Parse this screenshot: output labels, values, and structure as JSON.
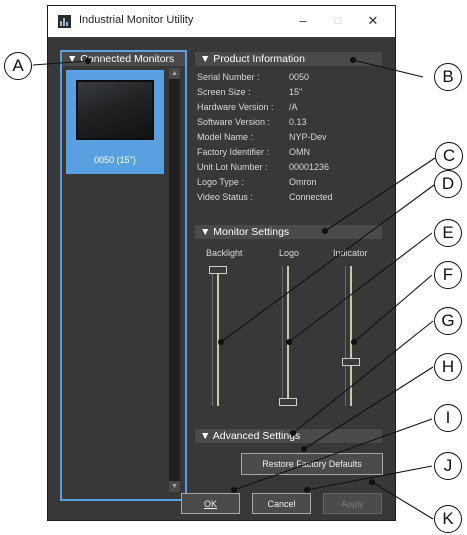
{
  "window": {
    "title": "Industrial Monitor Utility",
    "minimize_symbol": "–",
    "maximize_symbol": "□",
    "close_symbol": "✕"
  },
  "connected_monitors": {
    "header": "▼ Connected Monitors",
    "items": [
      {
        "label": "0050 (15\")",
        "selected": true
      }
    ]
  },
  "product_information": {
    "header": "▼ Product Information",
    "rows": [
      {
        "label": "Serial Number :",
        "value": "0050"
      },
      {
        "label": "Screen Size :",
        "value": "15\""
      },
      {
        "label": "Hardware Version :",
        "value": "/A"
      },
      {
        "label": "Software Version :",
        "value": "0.13"
      },
      {
        "label": "Model Name :",
        "value": "NYP-Dev"
      },
      {
        "label": "Factory Identifier :",
        "value": "OMN"
      },
      {
        "label": "Unit Lot Number :",
        "value": "00001236"
      },
      {
        "label": "Logo Type :",
        "value": "Omron"
      },
      {
        "label": "Video Status :",
        "value": "Connected"
      }
    ]
  },
  "monitor_settings": {
    "header": "▼ Monitor Settings",
    "sliders": [
      {
        "label": "Backlight",
        "level": 1.0
      },
      {
        "label": "Logo",
        "level": 0.0
      },
      {
        "label": "Indicator",
        "level": 0.3
      }
    ]
  },
  "advanced_settings": {
    "header": "▼ Advanced Settings",
    "restore_label": "Restore Factory Defaults"
  },
  "footer": {
    "ok_label": "OK",
    "cancel_label": "Cancel",
    "apply_label": "Apply"
  },
  "callouts": [
    "A",
    "B",
    "C",
    "D",
    "E",
    "F",
    "G",
    "H",
    "I",
    "J",
    "K"
  ],
  "colors": {
    "window_bg": "#383838",
    "header_bg": "#4a4a4a",
    "selection": "#58a0e0",
    "panel_border": "#5aa0e0"
  }
}
